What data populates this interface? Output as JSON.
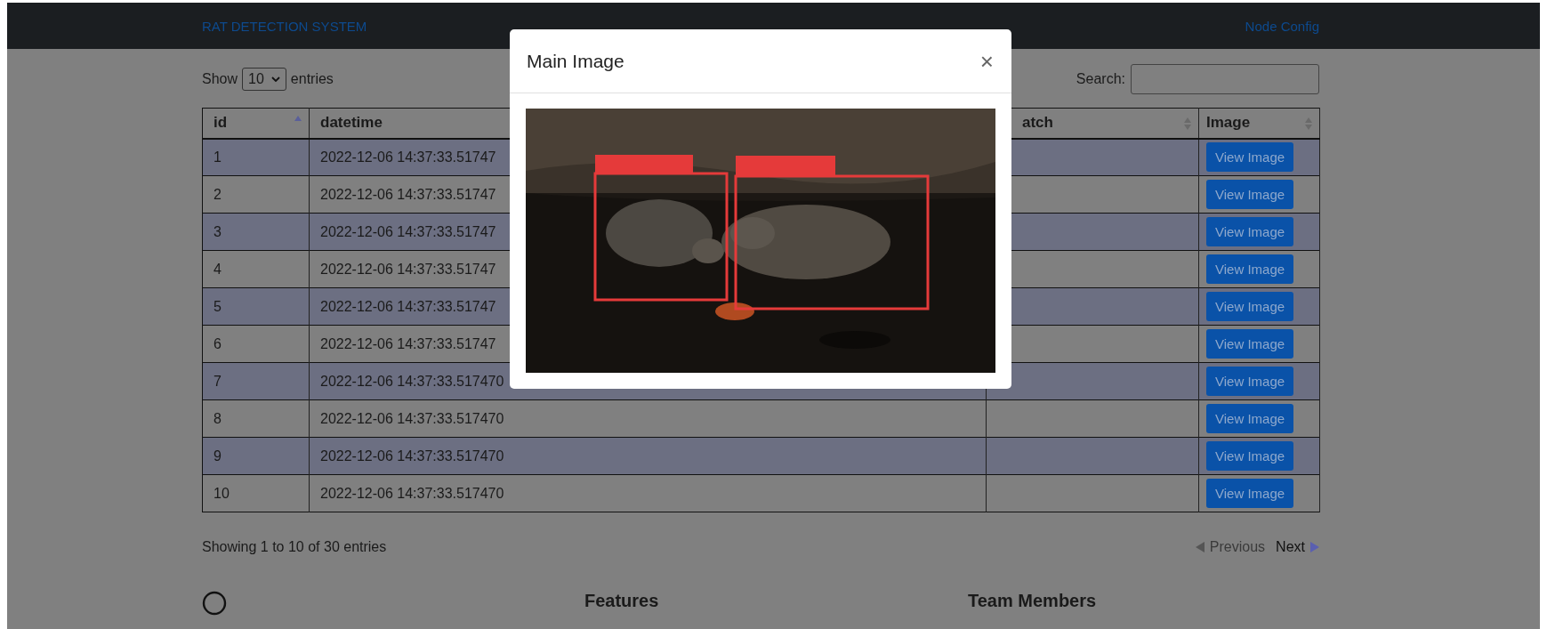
{
  "navbar": {
    "brand": "RAT DETECTION SYSTEM",
    "link": "Node Config"
  },
  "length_menu": {
    "before": "Show",
    "value": "10",
    "after": "entries"
  },
  "search": {
    "label": "Search:"
  },
  "table": {
    "columns": [
      {
        "label": "id",
        "sorted": true
      },
      {
        "label": "datetime"
      },
      {
        "label": "atch",
        "sorted": false
      },
      {
        "label": "Image",
        "sorted": false
      }
    ],
    "rows": [
      {
        "id": "1",
        "datetime": "2022-12-06 14:37:33.51747",
        "button": "View Image"
      },
      {
        "id": "2",
        "datetime": "2022-12-06 14:37:33.51747",
        "button": "View Image"
      },
      {
        "id": "3",
        "datetime": "2022-12-06 14:37:33.51747",
        "button": "View Image"
      },
      {
        "id": "4",
        "datetime": "2022-12-06 14:37:33.51747",
        "button": "View Image"
      },
      {
        "id": "5",
        "datetime": "2022-12-06 14:37:33.51747",
        "button": "View Image"
      },
      {
        "id": "6",
        "datetime": "2022-12-06 14:37:33.51747",
        "button": "View Image"
      },
      {
        "id": "7",
        "datetime": "2022-12-06 14:37:33.517470",
        "button": "View Image"
      },
      {
        "id": "8",
        "datetime": "2022-12-06 14:37:33.517470",
        "button": "View Image"
      },
      {
        "id": "9",
        "datetime": "2022-12-06 14:37:33.517470",
        "button": "View Image"
      },
      {
        "id": "10",
        "datetime": "2022-12-06 14:37:33.517470",
        "button": "View Image"
      }
    ]
  },
  "info": "Showing 1 to 10 of 30 entries",
  "pagination": [
    {
      "label": "Previous",
      "kind": "previous",
      "disabled": true
    },
    {
      "label": "Next",
      "kind": "next",
      "disabled": false
    }
  ],
  "footer": {
    "headings": [
      "Features",
      "Team Members"
    ]
  },
  "modal": {
    "title": "Main Image",
    "close": "×"
  }
}
